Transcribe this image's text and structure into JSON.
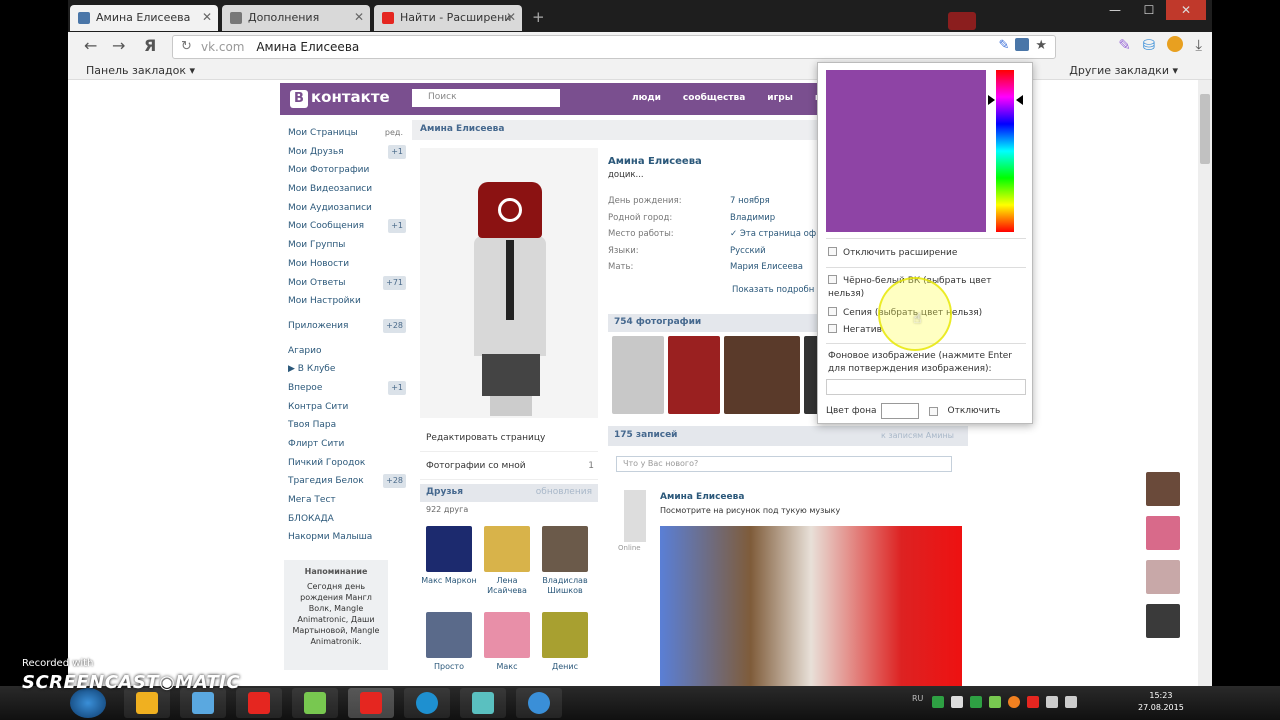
{
  "browser": {
    "tabs": [
      {
        "label": "Амина Елисеева",
        "active": true,
        "icon_color": "#4a76a8"
      },
      {
        "label": "Дополнения",
        "active": false,
        "icon_color": "#777777"
      },
      {
        "label": "Найти - Расширени",
        "active": false,
        "icon_color": "#e52620"
      }
    ],
    "new_tab": "+",
    "window_buttons": {
      "minimize": "—",
      "maximize": "☐",
      "close": "✕"
    },
    "back": "←",
    "forward": "→",
    "yandex_btn": "Я",
    "address": {
      "host": "vk.com",
      "query": "Амина Елисеева"
    },
    "bookmarks_left": "Панель закладок ▾",
    "bookmarks_right": "Другие закладки ▾"
  },
  "vk": {
    "logo": "контакте",
    "logo_badge": "В",
    "search_placeholder": "Поиск",
    "nav": [
      "люди",
      "сообщества",
      "игры",
      "му"
    ],
    "menu": [
      {
        "label": "Мои Страницы",
        "count": "ред.",
        "plain": true
      },
      {
        "label": "Мои Друзья",
        "count": "+1"
      },
      {
        "label": "Мои Фотографии",
        "count": ""
      },
      {
        "label": "Мои Видеозаписи",
        "count": ""
      },
      {
        "label": "Мои Аудиозаписи",
        "count": ""
      },
      {
        "label": "Мои Сообщения",
        "count": "+1"
      },
      {
        "label": "Мои Группы",
        "count": ""
      },
      {
        "label": "Мои Новости",
        "count": ""
      },
      {
        "label": "Мои Ответы",
        "count": "+71"
      },
      {
        "label": "Мои Настройки",
        "count": ""
      }
    ],
    "apps": {
      "label": "Приложения",
      "count": "+28"
    },
    "groups": [
      {
        "label": "Агарио",
        "count": ""
      },
      {
        "label": "▶ В Клубе",
        "count": ""
      },
      {
        "label": "Вперое",
        "count": "+1"
      },
      {
        "label": "Контра Сити",
        "count": ""
      },
      {
        "label": "Твоя Пара",
        "count": ""
      },
      {
        "label": "Флирт Сити",
        "count": ""
      },
      {
        "label": "Пичкий Городок",
        "count": ""
      },
      {
        "label": "Трагедия Белок",
        "count": "+28"
      },
      {
        "label": "Мега Тест",
        "count": ""
      },
      {
        "label": "БЛОКАДА",
        "count": ""
      },
      {
        "label": "Накорми Малыша",
        "count": ""
      }
    ],
    "reminder": {
      "title": "Напоминание",
      "text": "Сегодня день рождения Мангл Волк, Mangle Animatronic, Даши Мартыновой, Mangle Animatronik."
    },
    "page_title": "Амина Елисеева",
    "profile": {
      "name": "Амина Елисеева",
      "status": "доцик...",
      "fields": [
        {
          "k": "День рождения:",
          "v": "7 ноября"
        },
        {
          "k": "Родной город:",
          "v": "Владимир"
        },
        {
          "k": "Место работы:",
          "v": "✓ Эта страница оф"
        },
        {
          "k": "Языки:",
          "v": "Русский"
        },
        {
          "k": "Мать:",
          "v": "Мария Елисеева"
        }
      ],
      "more": "Показать подробн"
    },
    "profile_links": [
      {
        "label": "Редактировать страницу",
        "count": ""
      },
      {
        "label": "Фотографии со мной",
        "count": "1"
      }
    ],
    "friends": {
      "title": "Друзья",
      "updates": "обновления",
      "count": "922 друга",
      "items": [
        {
          "name": "Макс Маркон",
          "color": "#1c2a6e"
        },
        {
          "name": "Лена Исайчева",
          "color": "#d8b34a"
        },
        {
          "name": "Владислав Шишков",
          "color": "#6b5a4a"
        },
        {
          "name": "Просто",
          "color": "#5a6a8a"
        },
        {
          "name": "Макс",
          "color": "#e88fa8"
        },
        {
          "name": "Денис",
          "color": "#a8a030"
        }
      ]
    },
    "photos_title": "754 фотографии",
    "thumb_colors": [
      "#c8c8c8",
      "#9a2020",
      "#5a3a2a",
      "#333333"
    ],
    "posts_title": "175 записей",
    "wall_link": "к записям Амины",
    "post_placeholder": "Что у Вас нового?",
    "post": {
      "author": "Амина Елисеева",
      "text": "Посмотрите на рисунок под тукую музыку",
      "online": "Online"
    },
    "side_avatars": [
      "#6a4a3a",
      "#d86a8a",
      "#c8a8a8",
      "#3a3a3a"
    ]
  },
  "popup": {
    "selected_color": "#8e44a5",
    "disable": "Отключить расширение",
    "bw": "Чёрно-белый ВК (выбрать цвет нельзя)",
    "sepia": "Сепия (выбрать цвет нельзя)",
    "negative": "Негатив",
    "bg_label": "Фоновое изображение (нажмите Enter для потверждения изображения):",
    "bg_color_label": "Цвет фона",
    "bg_disable": "Отключить"
  },
  "taskbar": {
    "icons": [
      "#f0b020",
      "#5aa8e0",
      "#e52620",
      "#78c850",
      "#e52620",
      "#1e90d0",
      "#5ac0c0",
      "#3a8fd8"
    ],
    "lang": "RU",
    "time": "15:23",
    "date": "27.08.2015"
  },
  "watermark": {
    "small": "Recorded with",
    "main": "SCREENCAST◉MATIC"
  }
}
